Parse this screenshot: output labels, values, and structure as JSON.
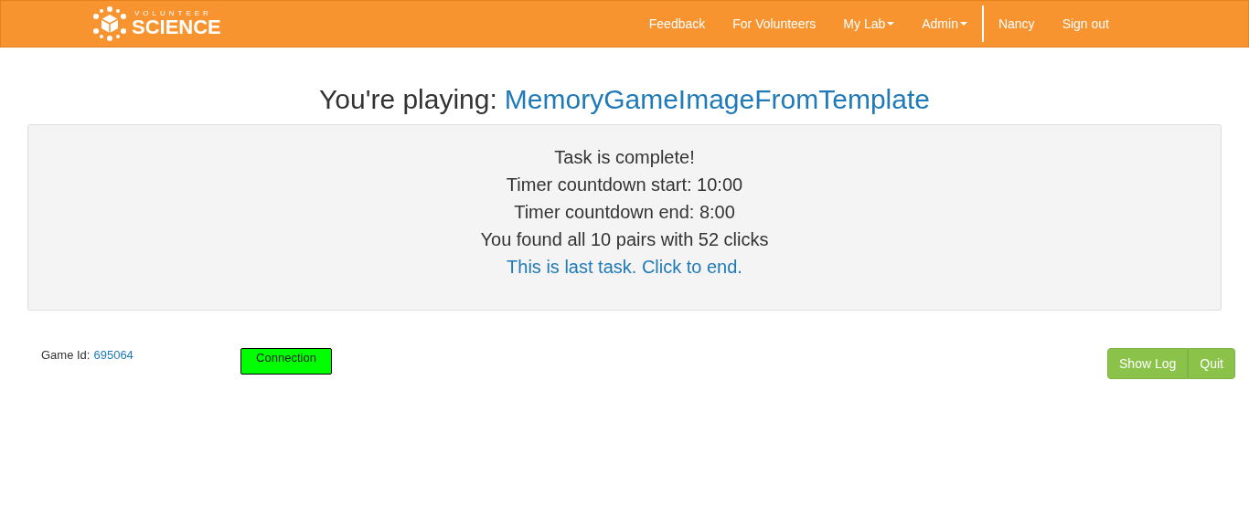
{
  "navbar": {
    "logo": {
      "top": "VOLUNTEER",
      "bottom": "SCIENCE"
    },
    "items": [
      {
        "label": "Feedback",
        "kind": "link"
      },
      {
        "label": "For Volunteers",
        "kind": "link"
      },
      {
        "label": "My Lab",
        "kind": "dropdown"
      },
      {
        "label": "Admin",
        "kind": "dropdown"
      },
      {
        "label": "Nancy",
        "kind": "divided"
      },
      {
        "label": "Sign out",
        "kind": "link"
      }
    ]
  },
  "heading": {
    "prefix": "You're playing:",
    "game": "MemoryGameImageFromTemplate"
  },
  "panel": {
    "lines": [
      {
        "text": "Task is complete!",
        "kind": "text"
      },
      {
        "text": "Timer countdown start: 10:00",
        "kind": "text"
      },
      {
        "text": "Timer countdown end: 8:00",
        "kind": "text"
      },
      {
        "text": "You found all 10 pairs with 52 clicks",
        "kind": "text"
      },
      {
        "text": "This is last task. Click to end.",
        "kind": "link"
      }
    ]
  },
  "footer": {
    "game_id_label": "Game Id:",
    "game_id": "695064",
    "connection": {
      "label": "Connection",
      "color": "#00ff00"
    },
    "buttons": [
      "Show Log",
      "Quit"
    ]
  }
}
